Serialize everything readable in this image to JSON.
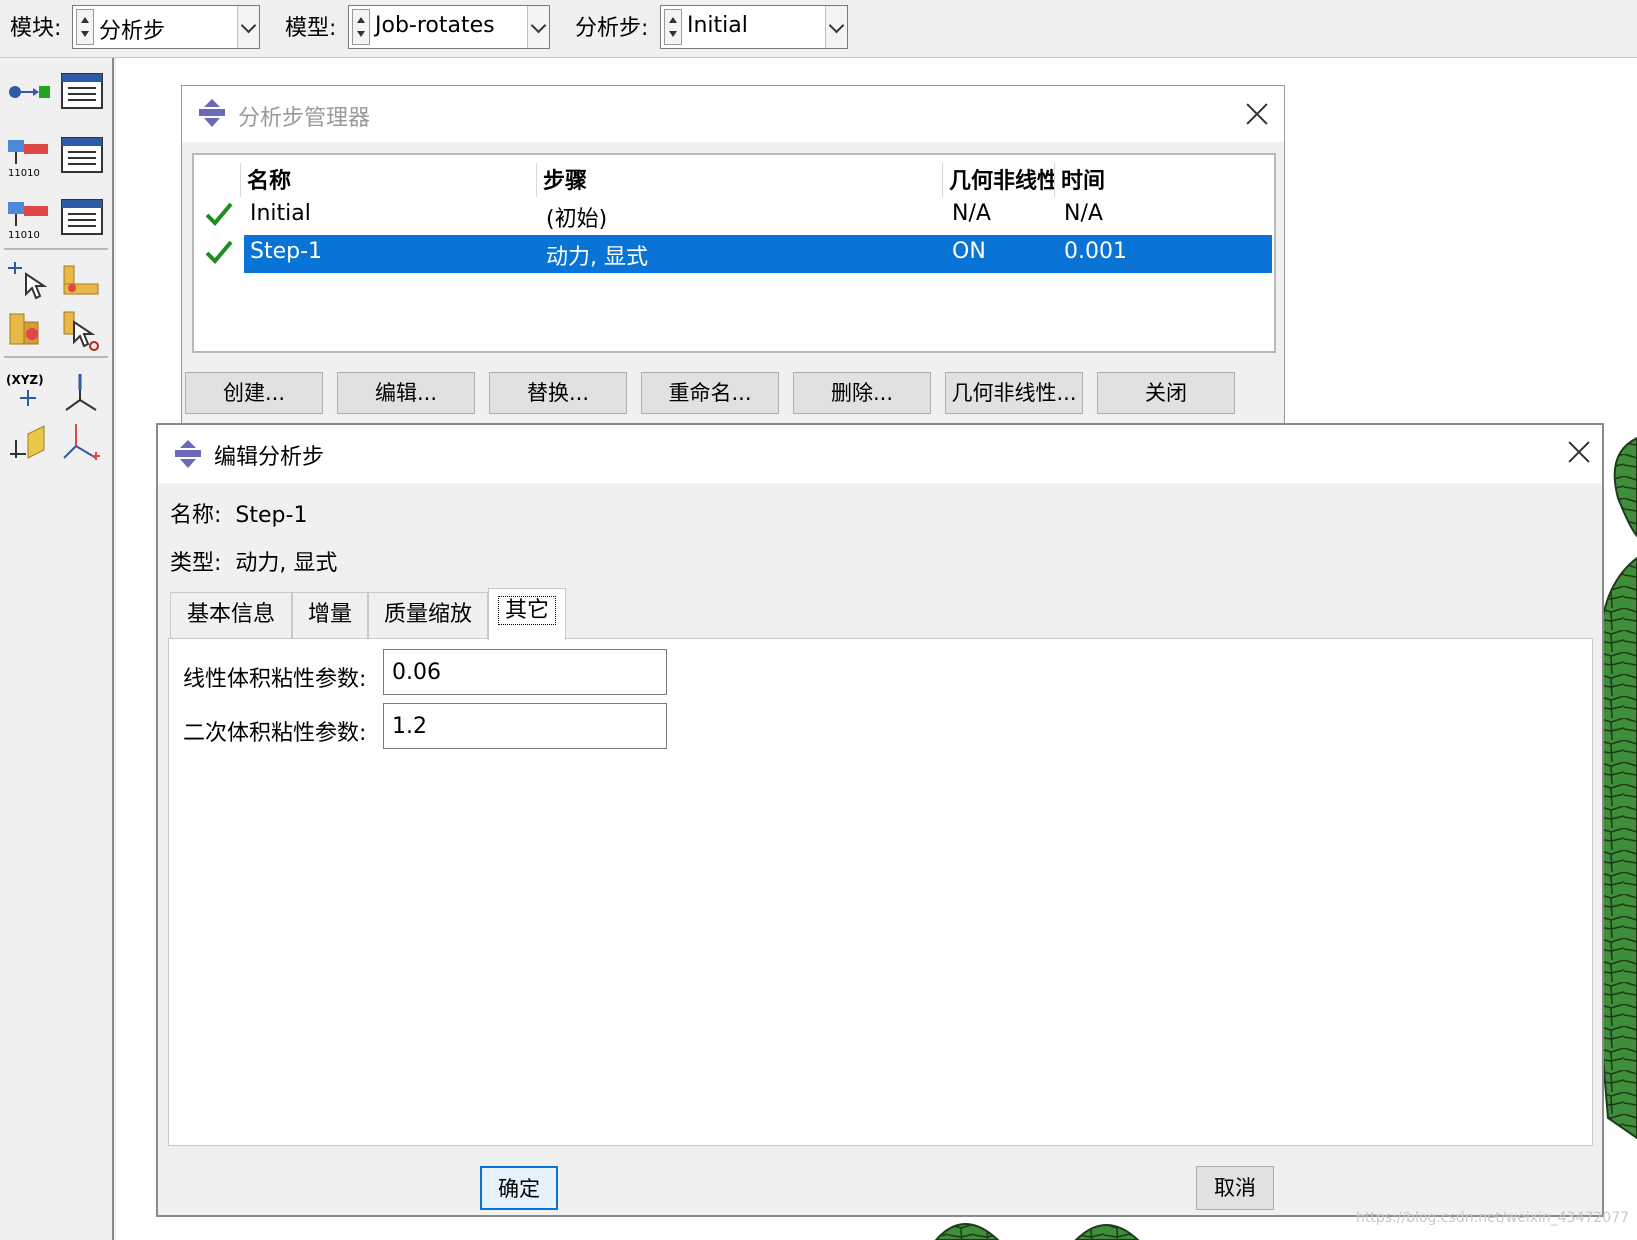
{
  "context_bar": {
    "module_label": "模块:",
    "module_value": "分析步",
    "model_label": "模型:",
    "model_value": "Job-rotates",
    "step_label": "分析步:",
    "step_value": "Initial"
  },
  "step_manager": {
    "title": "分析步管理器",
    "columns": [
      "名称",
      "步骤",
      "几何非线性",
      "时间"
    ],
    "rows": [
      {
        "name": "Initial",
        "procedure": "(初始)",
        "nlgeom": "N/A",
        "time": "N/A",
        "selected": false
      },
      {
        "name": "Step-1",
        "procedure": "动力, 显式",
        "nlgeom": "ON",
        "time": "0.001",
        "selected": true
      }
    ],
    "buttons": [
      "创建...",
      "编辑...",
      "替换...",
      "重命名...",
      "删除...",
      "几何非线性...",
      "关闭"
    ]
  },
  "edit_step": {
    "title": "编辑分析步",
    "name_label": "名称:",
    "name_value": "Step-1",
    "type_label": "类型:",
    "type_value": "动力, 显式",
    "tabs": [
      "基本信息",
      "增量",
      "质量缩放",
      "其它"
    ],
    "active_tab": "其它",
    "linear_bulk_label": "线性体积粘性参数:",
    "linear_bulk_value": "0.06",
    "quadratic_bulk_label": "二次体积粘性参数:",
    "quadratic_bulk_value": "1.2",
    "ok_label": "确定",
    "cancel_label": "取消"
  },
  "colors": {
    "selection": "#0a74d6",
    "check": "#1e8c1e",
    "mesh_fill": "#3f8f3a",
    "mesh_line": "#1e3a1a"
  },
  "watermark": "https://blog.csdn.net/weixin_43472077"
}
